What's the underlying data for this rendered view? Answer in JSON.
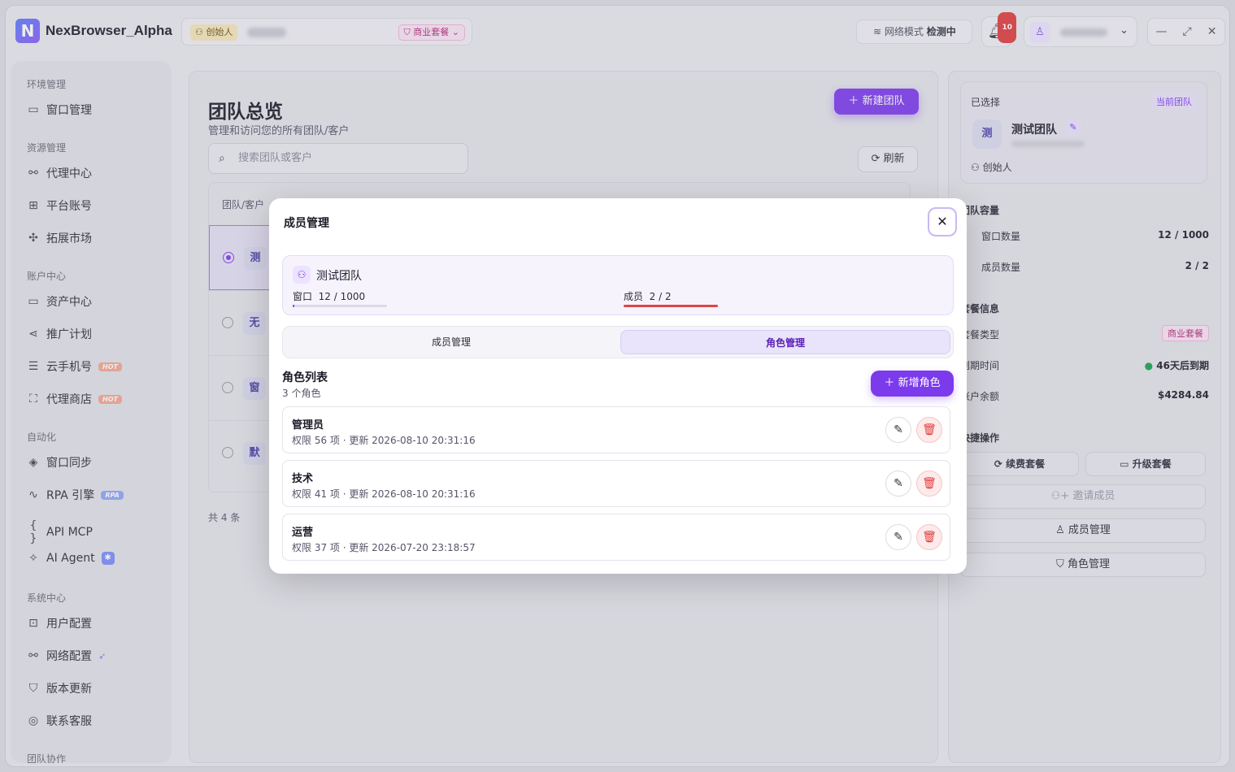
{
  "app": {
    "title": "NexBrowser_Alpha",
    "logo_letter": "N",
    "role_badge": "创始人",
    "plan_badge": "商业套餐",
    "network_label": "网络模式",
    "network_status": "检测中",
    "notification_count": "10"
  },
  "sidebar": {
    "groups": [
      {
        "label": "环境管理"
      },
      {
        "label": "资源管理"
      },
      {
        "label": "账户中心"
      },
      {
        "label": "自动化"
      },
      {
        "label": "系统中心"
      },
      {
        "label": "团队协作"
      }
    ],
    "items": [
      {
        "label": "窗口管理"
      },
      {
        "label": "代理中心"
      },
      {
        "label": "平台账号"
      },
      {
        "label": "拓展市场"
      },
      {
        "label": "资产中心"
      },
      {
        "label": "推广计划"
      },
      {
        "label": "云手机号",
        "badge": "HOT"
      },
      {
        "label": "代理商店",
        "badge": "HOT"
      },
      {
        "label": "窗口同步"
      },
      {
        "label": "RPA 引擎",
        "badge": "RPA"
      },
      {
        "label": "API MCP"
      },
      {
        "label": "AI Agent"
      },
      {
        "label": "用户配置"
      },
      {
        "label": "网络配置"
      },
      {
        "label": "版本更新"
      },
      {
        "label": "联系客服"
      }
    ]
  },
  "main": {
    "title": "团队总览",
    "subtitle": "管理和访问您的所有团队/客户",
    "new_team_button": "新建团队",
    "search_placeholder": "搜索团队或客户",
    "refresh_button": "刷新",
    "table_header": "团队/客户",
    "rows": [
      {
        "avatar": "测"
      },
      {
        "avatar": "无"
      },
      {
        "avatar": "窗"
      },
      {
        "avatar": "默"
      }
    ],
    "total": "共 4 条"
  },
  "right": {
    "selected_label": "已选择",
    "current_badge": "当前团队",
    "team_avatar": "测",
    "team_name": "测试团队",
    "team_role": "创始人",
    "capacity_title": "团队容量",
    "window_count_label": "窗口数量",
    "window_count_value": "12 / 1000",
    "member_count_label": "成员数量",
    "member_count_value": "2 / 2",
    "plan_title": "套餐信息",
    "plan_type_label": "套餐类型",
    "plan_type_value": "商业套餐",
    "expire_label": "到期时间",
    "expire_value": "46天后到期",
    "balance_label": "账户余额",
    "balance_value": "$4284.84",
    "quick_title": "快捷操作",
    "renew_button": "续费套餐",
    "upgrade_button": "升级套餐",
    "invite_button": "邀请成员",
    "member_mgmt_button": "成员管理",
    "role_mgmt_button": "角色管理"
  },
  "modal": {
    "title": "成员管理",
    "team_name": "测试团队",
    "window_label": "窗口",
    "window_value": "12 / 1000",
    "window_fraction": 0.012,
    "member_label": "成员",
    "member_value": "2 / 2",
    "member_fraction": 1.0,
    "tabs": [
      {
        "label": "成员管理"
      },
      {
        "label": "角色管理"
      }
    ],
    "list_title": "角色列表",
    "list_count": "3 个角色",
    "add_role_button": "新增角色",
    "roles": [
      {
        "name": "管理员",
        "meta": "权限 56 项 · 更新 2026-08-10 20:31:16"
      },
      {
        "name": "技术",
        "meta": "权限 41 项 · 更新 2026-08-10 20:31:16"
      },
      {
        "name": "运营",
        "meta": "权限 37 项 · 更新 2026-07-20 23:18:57"
      }
    ]
  },
  "colors": {
    "accent": "#7c3aed",
    "danger": "#e03b3b"
  }
}
